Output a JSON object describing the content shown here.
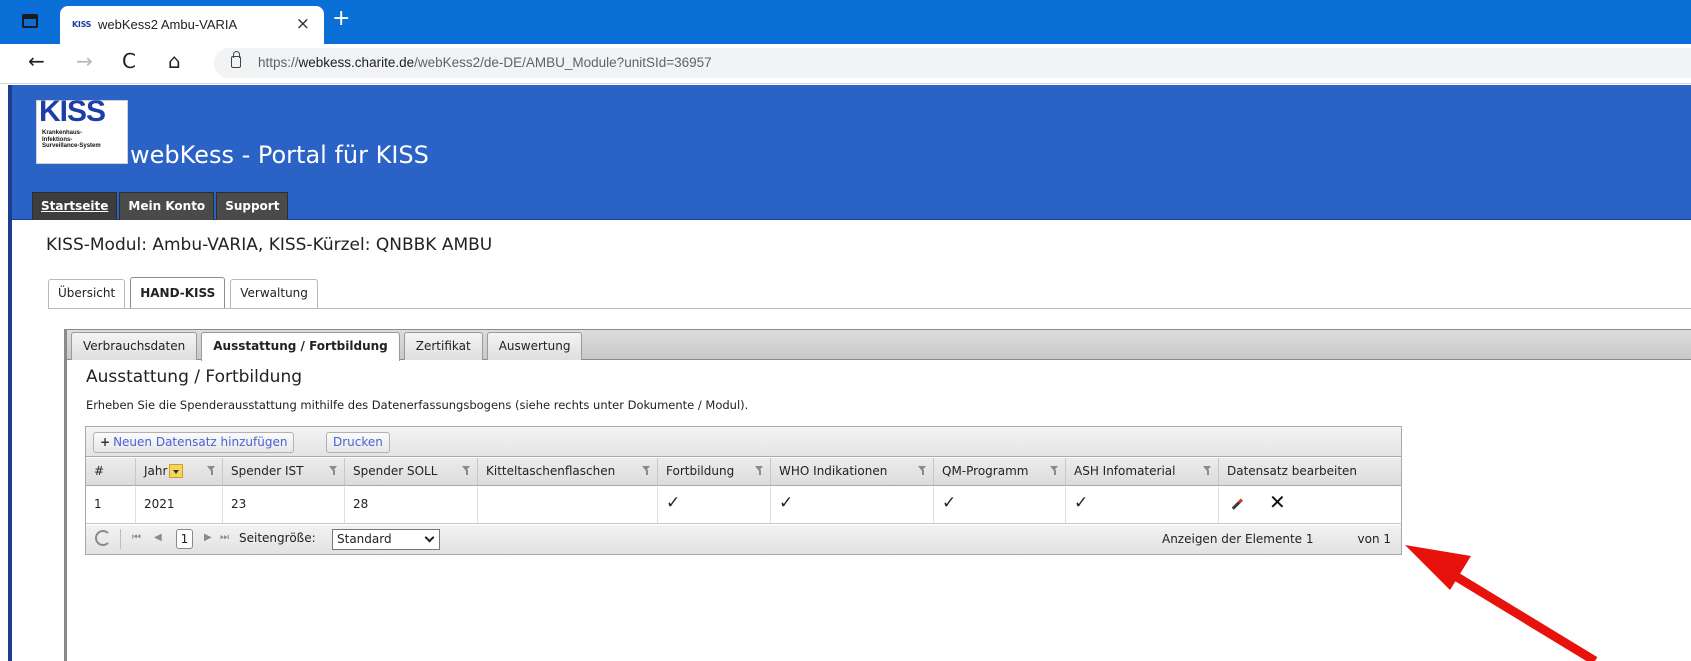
{
  "browser": {
    "tab_favicon": "KISS",
    "tab_title": "webKess2 Ambu-VARIA",
    "tab_close": "×",
    "new_tab": "+",
    "back": "←",
    "forward": "→",
    "reload": "C",
    "home": "⌂",
    "url_prefix": "https://",
    "url_domain": "webkess.charite.de",
    "url_path": "/webKess2/de-DE/AMBU_Module?unitSId=36957"
  },
  "header": {
    "logo_big": "KISS",
    "logo_small": "Krankenhaus-Infektions-Surveillance-System",
    "title": "webKess - Portal für KISS"
  },
  "top_nav": [
    "Startseite",
    "Mein Konto",
    "Support"
  ],
  "module_title": "KISS-Modul: Ambu-VARIA, KISS-Kürzel: QNBBK AMBU",
  "outer_tabs": [
    "Übersicht",
    "HAND-KISS",
    "Verwaltung"
  ],
  "inner_tabs": [
    "Verbrauchsdaten",
    "Ausstattung / Fortbildung",
    "Zertifikat",
    "Auswertung"
  ],
  "section": {
    "title": "Ausstattung / Fortbildung",
    "description": "Erheben Sie die Spenderausstattung mithilfe des Datenerfassungsbogens (siehe rechts unter Dokumente / Modul)."
  },
  "grid": {
    "add_button": "Neuen Datensatz hinzufügen",
    "add_icon": "+",
    "print_button": "Drucken",
    "columns": [
      "#",
      "Jahr",
      "Spender IST",
      "Spender SOLL",
      "Kitteltaschenflaschen",
      "Fortbildung",
      "WHO Indikationen",
      "QM-Programm",
      "ASH Infomaterial",
      "Datensatz bearbeiten"
    ],
    "row": {
      "num": "1",
      "jahr": "2021",
      "spender_ist": "23",
      "spender_soll": "28",
      "kitteltaschenflaschen": "",
      "fortbildung": "✓",
      "who": "✓",
      "qm": "✓",
      "ash": "✓"
    },
    "delete_glyph": "✕",
    "pager": {
      "first": "⏮",
      "prev": "◀",
      "page": "1",
      "next": "▶",
      "last": "⏭",
      "page_size_label": "Seitengröße:",
      "page_size_value": "Standard",
      "info_visible": "Anzeigen der Elemente 1",
      "info_end": "von 1"
    }
  },
  "annotation": {
    "arrow_color": "#e8120c"
  }
}
